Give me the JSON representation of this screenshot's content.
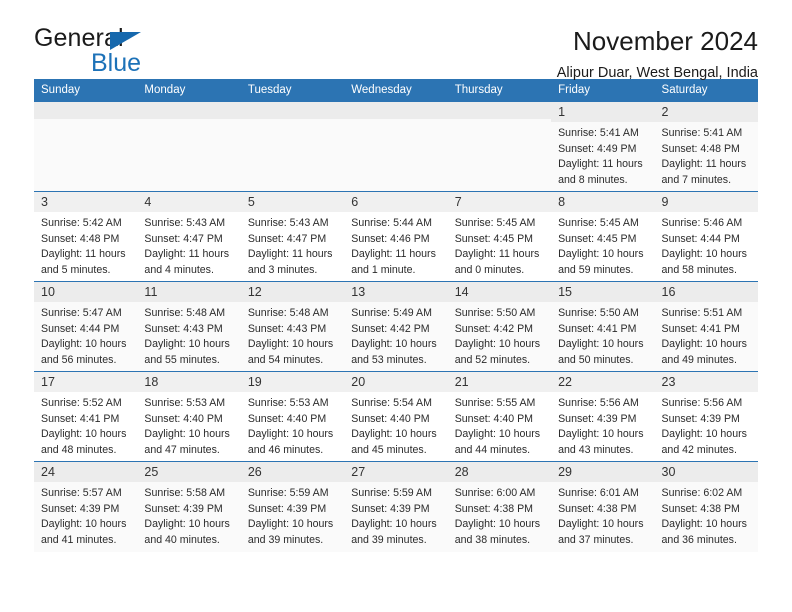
{
  "brand": {
    "name_top": "General",
    "name_bottom": "Blue",
    "accent_color": "#1d72b8"
  },
  "header": {
    "title": "November 2024",
    "subtitle": "Alipur Duar, West Bengal, India"
  },
  "calendar": {
    "header_color": "#2c74b3",
    "weekday_headers": [
      "Sunday",
      "Monday",
      "Tuesday",
      "Wednesday",
      "Thursday",
      "Friday",
      "Saturday"
    ],
    "weeks": [
      [
        {
          "day": "",
          "empty": true
        },
        {
          "day": "",
          "empty": true
        },
        {
          "day": "",
          "empty": true
        },
        {
          "day": "",
          "empty": true
        },
        {
          "day": "",
          "empty": true
        },
        {
          "day": "1",
          "sunrise": "Sunrise: 5:41 AM",
          "sunset": "Sunset: 4:49 PM",
          "daylight": "Daylight: 11 hours and 8 minutes."
        },
        {
          "day": "2",
          "sunrise": "Sunrise: 5:41 AM",
          "sunset": "Sunset: 4:48 PM",
          "daylight": "Daylight: 11 hours and 7 minutes."
        }
      ],
      [
        {
          "day": "3",
          "sunrise": "Sunrise: 5:42 AM",
          "sunset": "Sunset: 4:48 PM",
          "daylight": "Daylight: 11 hours and 5 minutes."
        },
        {
          "day": "4",
          "sunrise": "Sunrise: 5:43 AM",
          "sunset": "Sunset: 4:47 PM",
          "daylight": "Daylight: 11 hours and 4 minutes."
        },
        {
          "day": "5",
          "sunrise": "Sunrise: 5:43 AM",
          "sunset": "Sunset: 4:47 PM",
          "daylight": "Daylight: 11 hours and 3 minutes."
        },
        {
          "day": "6",
          "sunrise": "Sunrise: 5:44 AM",
          "sunset": "Sunset: 4:46 PM",
          "daylight": "Daylight: 11 hours and 1 minute."
        },
        {
          "day": "7",
          "sunrise": "Sunrise: 5:45 AM",
          "sunset": "Sunset: 4:45 PM",
          "daylight": "Daylight: 11 hours and 0 minutes."
        },
        {
          "day": "8",
          "sunrise": "Sunrise: 5:45 AM",
          "sunset": "Sunset: 4:45 PM",
          "daylight": "Daylight: 10 hours and 59 minutes."
        },
        {
          "day": "9",
          "sunrise": "Sunrise: 5:46 AM",
          "sunset": "Sunset: 4:44 PM",
          "daylight": "Daylight: 10 hours and 58 minutes."
        }
      ],
      [
        {
          "day": "10",
          "sunrise": "Sunrise: 5:47 AM",
          "sunset": "Sunset: 4:44 PM",
          "daylight": "Daylight: 10 hours and 56 minutes."
        },
        {
          "day": "11",
          "sunrise": "Sunrise: 5:48 AM",
          "sunset": "Sunset: 4:43 PM",
          "daylight": "Daylight: 10 hours and 55 minutes."
        },
        {
          "day": "12",
          "sunrise": "Sunrise: 5:48 AM",
          "sunset": "Sunset: 4:43 PM",
          "daylight": "Daylight: 10 hours and 54 minutes."
        },
        {
          "day": "13",
          "sunrise": "Sunrise: 5:49 AM",
          "sunset": "Sunset: 4:42 PM",
          "daylight": "Daylight: 10 hours and 53 minutes."
        },
        {
          "day": "14",
          "sunrise": "Sunrise: 5:50 AM",
          "sunset": "Sunset: 4:42 PM",
          "daylight": "Daylight: 10 hours and 52 minutes."
        },
        {
          "day": "15",
          "sunrise": "Sunrise: 5:50 AM",
          "sunset": "Sunset: 4:41 PM",
          "daylight": "Daylight: 10 hours and 50 minutes."
        },
        {
          "day": "16",
          "sunrise": "Sunrise: 5:51 AM",
          "sunset": "Sunset: 4:41 PM",
          "daylight": "Daylight: 10 hours and 49 minutes."
        }
      ],
      [
        {
          "day": "17",
          "sunrise": "Sunrise: 5:52 AM",
          "sunset": "Sunset: 4:41 PM",
          "daylight": "Daylight: 10 hours and 48 minutes."
        },
        {
          "day": "18",
          "sunrise": "Sunrise: 5:53 AM",
          "sunset": "Sunset: 4:40 PM",
          "daylight": "Daylight: 10 hours and 47 minutes."
        },
        {
          "day": "19",
          "sunrise": "Sunrise: 5:53 AM",
          "sunset": "Sunset: 4:40 PM",
          "daylight": "Daylight: 10 hours and 46 minutes."
        },
        {
          "day": "20",
          "sunrise": "Sunrise: 5:54 AM",
          "sunset": "Sunset: 4:40 PM",
          "daylight": "Daylight: 10 hours and 45 minutes."
        },
        {
          "day": "21",
          "sunrise": "Sunrise: 5:55 AM",
          "sunset": "Sunset: 4:40 PM",
          "daylight": "Daylight: 10 hours and 44 minutes."
        },
        {
          "day": "22",
          "sunrise": "Sunrise: 5:56 AM",
          "sunset": "Sunset: 4:39 PM",
          "daylight": "Daylight: 10 hours and 43 minutes."
        },
        {
          "day": "23",
          "sunrise": "Sunrise: 5:56 AM",
          "sunset": "Sunset: 4:39 PM",
          "daylight": "Daylight: 10 hours and 42 minutes."
        }
      ],
      [
        {
          "day": "24",
          "sunrise": "Sunrise: 5:57 AM",
          "sunset": "Sunset: 4:39 PM",
          "daylight": "Daylight: 10 hours and 41 minutes."
        },
        {
          "day": "25",
          "sunrise": "Sunrise: 5:58 AM",
          "sunset": "Sunset: 4:39 PM",
          "daylight": "Daylight: 10 hours and 40 minutes."
        },
        {
          "day": "26",
          "sunrise": "Sunrise: 5:59 AM",
          "sunset": "Sunset: 4:39 PM",
          "daylight": "Daylight: 10 hours and 39 minutes."
        },
        {
          "day": "27",
          "sunrise": "Sunrise: 5:59 AM",
          "sunset": "Sunset: 4:39 PM",
          "daylight": "Daylight: 10 hours and 39 minutes."
        },
        {
          "day": "28",
          "sunrise": "Sunrise: 6:00 AM",
          "sunset": "Sunset: 4:38 PM",
          "daylight": "Daylight: 10 hours and 38 minutes."
        },
        {
          "day": "29",
          "sunrise": "Sunrise: 6:01 AM",
          "sunset": "Sunset: 4:38 PM",
          "daylight": "Daylight: 10 hours and 37 minutes."
        },
        {
          "day": "30",
          "sunrise": "Sunrise: 6:02 AM",
          "sunset": "Sunset: 4:38 PM",
          "daylight": "Daylight: 10 hours and 36 minutes."
        }
      ]
    ]
  }
}
